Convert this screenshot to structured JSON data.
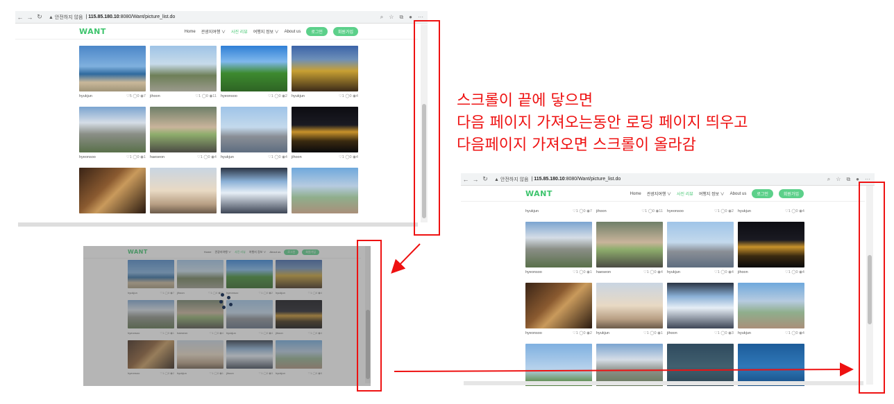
{
  "browser": {
    "security_label": "▲ 안전하지 않음",
    "url_host": "115.85.180.10",
    "url_rest": ":8080/Want/picture_list.do"
  },
  "site": {
    "logo": "WANT",
    "menu": [
      "Home",
      "관광지여행 ∨",
      "사진 리뷰",
      "여행지 정보 ∨",
      "About us"
    ],
    "login": "로그인",
    "signup": "회원가입"
  },
  "annotation": {
    "line1": "스크롤이 끝에 닿으면",
    "line2": "다음 페이지 가져오는동안 로딩 페이지 띄우고",
    "line3": "다음페이지 가져오면 스크롤이 올라감"
  },
  "panel1": {
    "cards": [
      {
        "user": "hyukjun",
        "stats": "♡5 ◯0 ◉7",
        "img": "beach"
      },
      {
        "user": "jihoon",
        "stats": "♡1 ◯0 ◉11",
        "img": "park"
      },
      {
        "user": "hyeonsoo",
        "stats": "♡1 ◯0 ◉2",
        "img": "tree"
      },
      {
        "user": "hyukjun",
        "stats": "♡1 ◯0 ◉4",
        "img": "bottles"
      },
      {
        "user": "hyeonsoo",
        "stats": "♡1 ◯0 ◉1",
        "img": "mountain"
      },
      {
        "user": "haeseon",
        "stats": "♡1 ◯0 ◉4",
        "img": "hand"
      },
      {
        "user": "hyukjun",
        "stats": "♡1 ◯0 ◉4",
        "img": "sea"
      },
      {
        "user": "jihoon",
        "stats": "♡1 ◯0 ◉4",
        "img": "palace"
      },
      {
        "user": "",
        "stats": "",
        "img": "bottle"
      },
      {
        "user": "",
        "stats": "",
        "img": "eiffel"
      },
      {
        "user": "",
        "stats": "",
        "img": "train"
      },
      {
        "user": "",
        "stats": "",
        "img": "terrace"
      }
    ]
  },
  "panel2": {
    "cards": [
      {
        "user": "hyukjun",
        "stats": "♡1 ◯0 ◉7",
        "img": "beach"
      },
      {
        "user": "jihoon",
        "stats": "♡1 ◯0 ◉11",
        "img": "park"
      },
      {
        "user": "hyeonsoo",
        "stats": "♡1 ◯0 ◉2",
        "img": "tree"
      },
      {
        "user": "hyukjun",
        "stats": "♡1 ◯0 ◉4",
        "img": "bottles"
      },
      {
        "user": "hyeonsoo",
        "stats": "♡1 ◯0 ◉1",
        "img": "mountain"
      },
      {
        "user": "haeseon",
        "stats": "♡1 ◯0 ◉4",
        "img": "hand"
      },
      {
        "user": "hyukjun",
        "stats": "♡1 ◯0 ◉4",
        "img": "sea"
      },
      {
        "user": "jihoon",
        "stats": "♡1 ◯0 ◉4",
        "img": "palace"
      },
      {
        "user": "hyeonsoo",
        "stats": "♡1 ◯0 ◉2",
        "img": "bottle"
      },
      {
        "user": "hyukjun",
        "stats": "♡1 ◯0 ◉1",
        "img": "eiffel"
      },
      {
        "user": "jihoon",
        "stats": "♡1 ◯0 ◉3",
        "img": "train"
      },
      {
        "user": "hyukjun",
        "stats": "♡1 ◯0 ◉5",
        "img": "terrace"
      }
    ]
  },
  "panel3": {
    "cards": [
      {
        "user": "hyukjun",
        "stats": "♡1 ◯0 ◉7",
        "img": "none"
      },
      {
        "user": "jihoon",
        "stats": "♡1 ◯0 ◉11",
        "img": "none"
      },
      {
        "user": "hyeonsoo",
        "stats": "♡1 ◯0 ◉2",
        "img": "none"
      },
      {
        "user": "hyukjun",
        "stats": "♡1 ◯0 ◉4",
        "img": "none"
      },
      {
        "user": "hyeonsoo",
        "stats": "♡1 ◯0 ◉1",
        "img": "mountain"
      },
      {
        "user": "haeseon",
        "stats": "♡1 ◯0 ◉4",
        "img": "hand"
      },
      {
        "user": "hyukjun",
        "stats": "♡1 ◯0 ◉4",
        "img": "sea"
      },
      {
        "user": "jihoon",
        "stats": "♡1 ◯0 ◉4",
        "img": "palace"
      },
      {
        "user": "hyeonsoo",
        "stats": "♡1 ◯0 ◉2",
        "img": "bottle"
      },
      {
        "user": "hyukjun",
        "stats": "♡1 ◯0 ◉1",
        "img": "eiffel"
      },
      {
        "user": "jihoon",
        "stats": "♡1 ◯0 ◉3",
        "img": "train"
      },
      {
        "user": "hyukjun",
        "stats": "♡1 ◯0 ◉4",
        "img": "terrace"
      },
      {
        "user": "",
        "stats": "",
        "img": "eiffel2"
      },
      {
        "user": "",
        "stats": "",
        "img": "mountain"
      },
      {
        "user": "",
        "stats": "",
        "img": "chalk"
      },
      {
        "user": "",
        "stats": "",
        "img": "swim"
      }
    ]
  },
  "colors": {
    "brand": "#3ec46d",
    "annotation": "#ee1111",
    "heart": "#ee3333"
  }
}
